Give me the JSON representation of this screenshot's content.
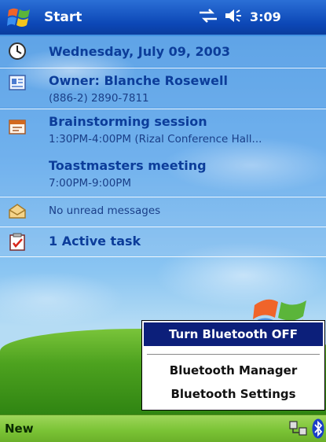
{
  "titlebar": {
    "app": "Start",
    "status_icons": "⇄ ◀ε",
    "time": "3:09"
  },
  "today": {
    "date": "Wednesday, July 09, 2003",
    "owner_name": "Owner: Blanche Rosewell",
    "owner_phone": "(886-2) 2890-7811",
    "appointments": [
      {
        "title": "Brainstorming session",
        "detail": "1:30PM-4:00PM (Rizal Conference Hall..."
      },
      {
        "title": "Toastmasters meeting",
        "detail": "7:00PM-9:00PM"
      }
    ],
    "messages": "No unread messages",
    "tasks": "1 Active task"
  },
  "popup_menu": {
    "items": [
      "Turn Bluetooth OFF",
      "Bluetooth Manager",
      "Bluetooth Settings"
    ],
    "selected_index": 0
  },
  "bottombar": {
    "left_label": "New"
  },
  "icons": [
    "start-flag-icon",
    "connectivity-icon",
    "speaker-icon",
    "clock-icon",
    "owner-card-icon",
    "calendar-icon",
    "inbox-icon",
    "tasks-icon",
    "network-tray-icon",
    "bluetooth-icon"
  ],
  "colors": {
    "titlebar": "#0c47b6",
    "menu_highlight": "#0c1f7a",
    "today_text": "#0c3d9a",
    "bottombar": "#79c234"
  }
}
